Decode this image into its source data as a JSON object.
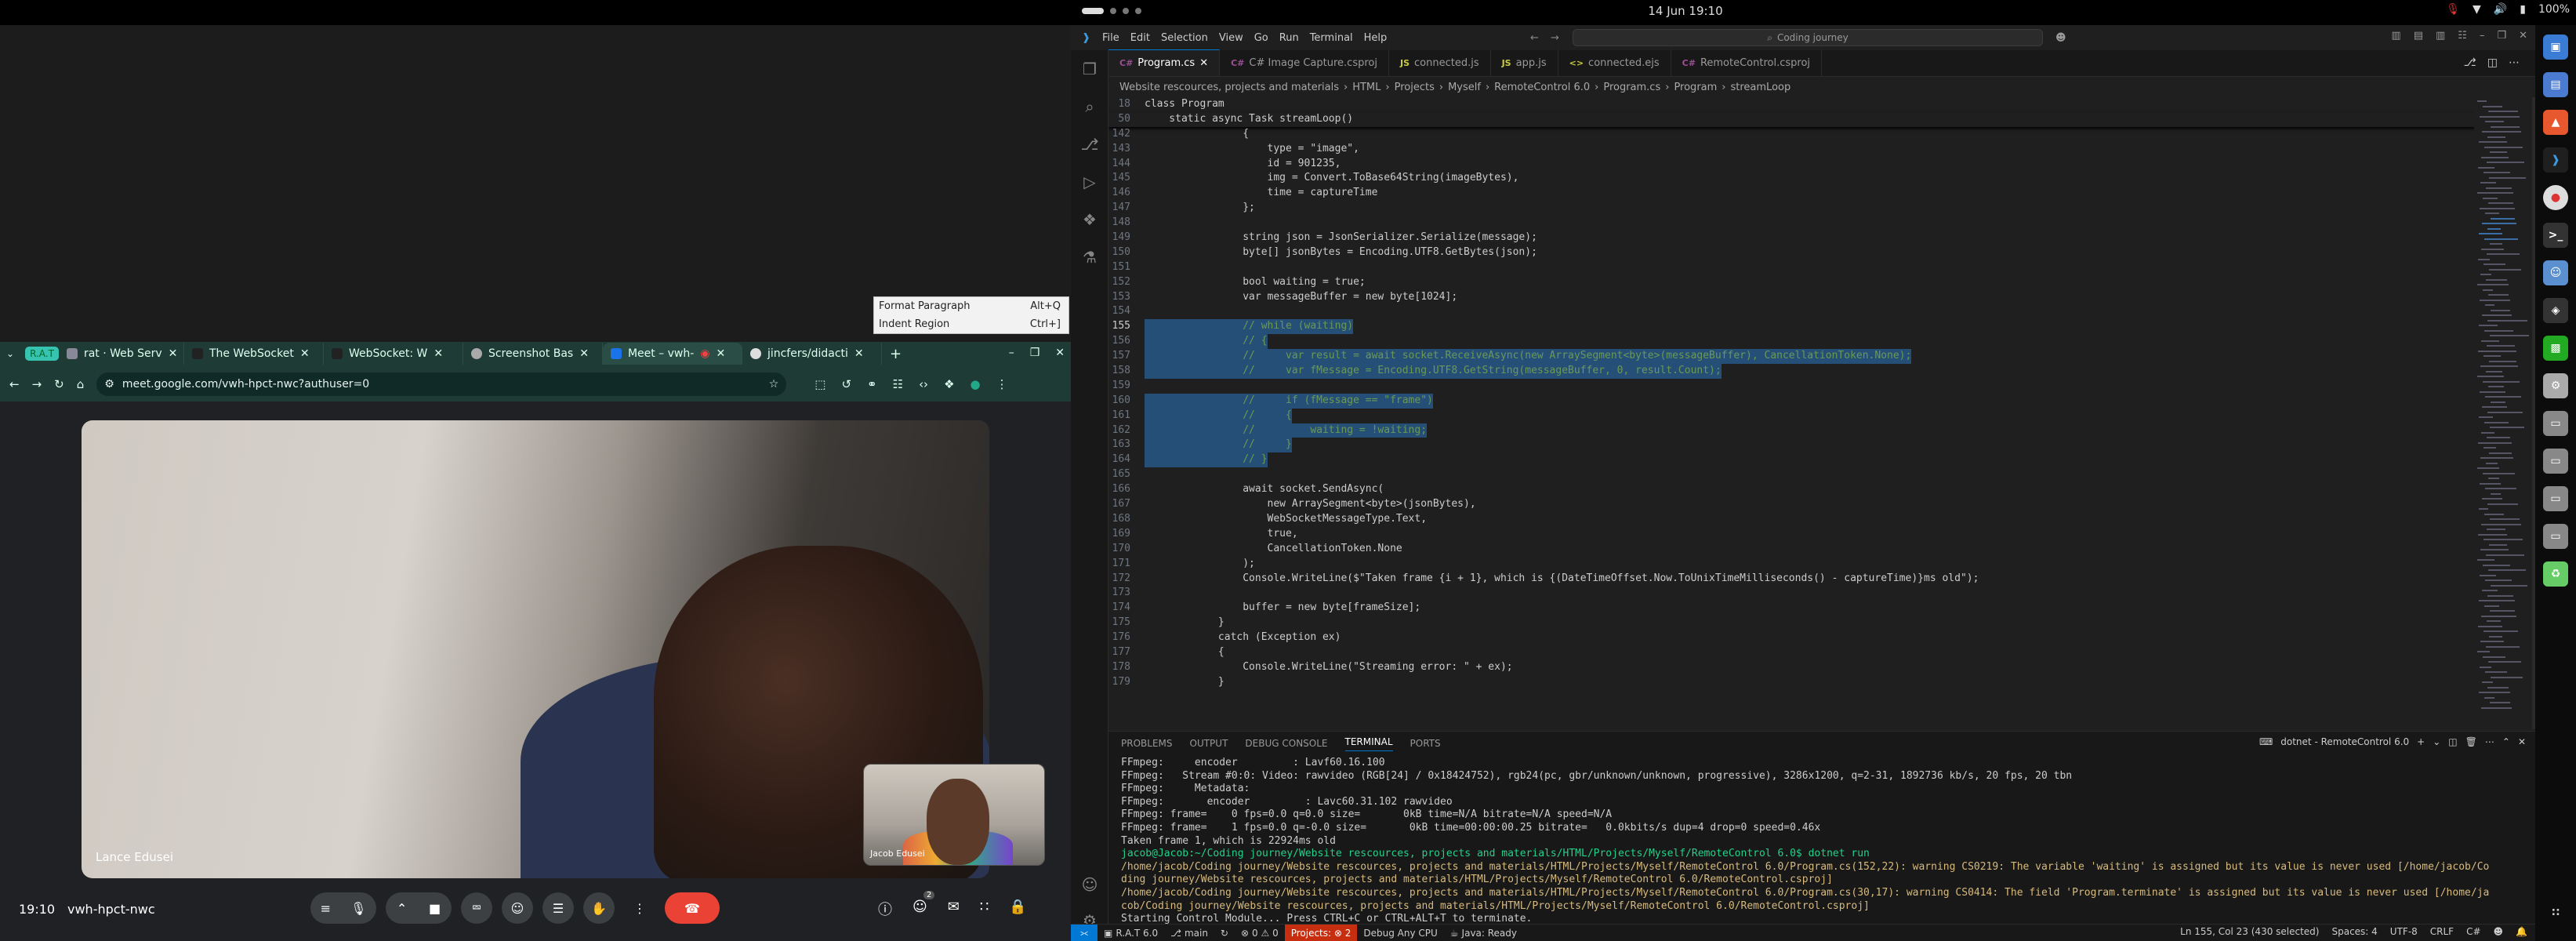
{
  "topbar": {
    "datetime": "14 Jun  19:10",
    "battery": "100%"
  },
  "context_menu": {
    "items": [
      {
        "label": "Format Paragraph",
        "shortcut": "Alt+Q"
      },
      {
        "label": "Indent Region",
        "shortcut": "Ctrl+]"
      }
    ]
  },
  "browser": {
    "tab_group": "R.A.T",
    "tabs": [
      {
        "label": "rat · Web Serv"
      },
      {
        "label": "The WebSocket"
      },
      {
        "label": "WebSocket: W"
      },
      {
        "label": "Screenshot Bas"
      },
      {
        "label": "Meet – vwh-"
      },
      {
        "label": "jincfers/didacti"
      }
    ],
    "url": "meet.google.com/vwh-hpct-nwc?authuser=0"
  },
  "meet": {
    "main_participant": "Lance Edusei",
    "self_participant": "Jacob Edusei",
    "time": "19:10",
    "meeting_code": "vwh-hpct-nwc",
    "people_count": "2"
  },
  "vscode": {
    "menu": [
      "File",
      "Edit",
      "Selection",
      "View",
      "Go",
      "Run",
      "Terminal",
      "Help"
    ],
    "command_center": "Coding journey",
    "tabs": [
      {
        "label": "Program.cs",
        "icon": "C#",
        "color": "#9b4f96"
      },
      {
        "label": "C# Image Capture.csproj",
        "icon": "C#",
        "color": "#9b4f96"
      },
      {
        "label": "connected.js",
        "icon": "JS",
        "color": "#cbcb41"
      },
      {
        "label": "app.js",
        "icon": "JS",
        "color": "#cbcb41"
      },
      {
        "label": "connected.ejs",
        "icon": "<>",
        "color": "#cbcb41"
      },
      {
        "label": "RemoteControl.csproj",
        "icon": "C#",
        "color": "#9b4f96"
      }
    ],
    "breadcrumbs": [
      "Website rescources, projects and materials",
      "HTML",
      "Projects",
      "Myself",
      "RemoteControl 6.0",
      "Program.cs",
      "Program",
      "streamLoop"
    ],
    "sticky_lines": [
      {
        "n": "18",
        "t": "class Program"
      },
      {
        "n": "50",
        "t": "    static async Task streamLoop()"
      }
    ],
    "code_lines": [
      {
        "n": "142",
        "t": "                {"
      },
      {
        "n": "143",
        "t": "                    type = \"image\","
      },
      {
        "n": "144",
        "t": "                    id = 901235,"
      },
      {
        "n": "145",
        "t": "                    img = Convert.ToBase64String(imageBytes),"
      },
      {
        "n": "146",
        "t": "                    time = captureTime"
      },
      {
        "n": "147",
        "t": "                };"
      },
      {
        "n": "148",
        "t": ""
      },
      {
        "n": "149",
        "t": "                string json = JsonSerializer.Serialize(message);"
      },
      {
        "n": "150",
        "t": "                byte[] jsonBytes = Encoding.UTF8.GetBytes(json);"
      },
      {
        "n": "151",
        "t": ""
      },
      {
        "n": "152",
        "t": "                bool waiting = true;"
      },
      {
        "n": "153",
        "t": "                var messageBuffer = new byte[1024];"
      },
      {
        "n": "154",
        "t": ""
      },
      {
        "n": "155",
        "t": "                // while (waiting)"
      },
      {
        "n": "156",
        "t": "                // {"
      },
      {
        "n": "157",
        "t": "                //     var result = await socket.ReceiveAsync(new ArraySegment<byte>(messageBuffer), CancellationToken.None);"
      },
      {
        "n": "158",
        "t": "                //     var fMessage = Encoding.UTF8.GetString(messageBuffer, 0, result.Count);"
      },
      {
        "n": "159",
        "t": ""
      },
      {
        "n": "160",
        "t": "                //     if (fMessage == \"frame\")"
      },
      {
        "n": "161",
        "t": "                //     {"
      },
      {
        "n": "162",
        "t": "                //         waiting = !waiting;"
      },
      {
        "n": "163",
        "t": "                //     }"
      },
      {
        "n": "164",
        "t": "                // }"
      },
      {
        "n": "165",
        "t": ""
      },
      {
        "n": "166",
        "t": "                await socket.SendAsync("
      },
      {
        "n": "167",
        "t": "                    new ArraySegment<byte>(jsonBytes),"
      },
      {
        "n": "168",
        "t": "                    WebSocketMessageType.Text,"
      },
      {
        "n": "169",
        "t": "                    true,"
      },
      {
        "n": "170",
        "t": "                    CancellationToken.None"
      },
      {
        "n": "171",
        "t": "                );"
      },
      {
        "n": "172",
        "t": "                Console.WriteLine($\"Taken frame {i + 1}, which is {(DateTimeOffset.Now.ToUnixTimeMilliseconds() - captureTime)}ms old\");"
      },
      {
        "n": "173",
        "t": ""
      },
      {
        "n": "174",
        "t": "                buffer = new byte[frameSize];"
      },
      {
        "n": "175",
        "t": "            }"
      },
      {
        "n": "176",
        "t": "            catch (Exception ex)"
      },
      {
        "n": "177",
        "t": "            {"
      },
      {
        "n": "178",
        "t": "                Console.WriteLine(\"Streaming error: \" + ex);"
      },
      {
        "n": "179",
        "t": "            }"
      }
    ],
    "panel_tabs": [
      "PROBLEMS",
      "OUTPUT",
      "DEBUG CONSOLE",
      "TERMINAL",
      "PORTS"
    ],
    "terminal_name": "dotnet - RemoteControl 6.0",
    "terminal_lines": [
      {
        "t": "FFmpeg:     encoder         : Lavf60.16.100",
        "k": ""
      },
      {
        "t": "FFmpeg:   Stream #0:0: Video: rawvideo (RGB[24] / 0x18424752), rgb24(pc, gbr/unknown/unknown, progressive), 3286x1200, q=2-31, 1892736 kb/s, 20 fps, 20 tbn",
        "k": ""
      },
      {
        "t": "FFmpeg:     Metadata:",
        "k": ""
      },
      {
        "t": "FFmpeg:       encoder         : Lavc60.31.102 rawvideo",
        "k": ""
      },
      {
        "t": "FFmpeg: frame=    0 fps=0.0 q=0.0 size=       0kB time=N/A bitrate=N/A speed=N/A",
        "k": ""
      },
      {
        "t": "FFmpeg: frame=    1 fps=0.0 q=-0.0 size=       0kB time=00:00:00.25 bitrate=   0.0kbits/s dup=4 drop=0 speed=0.46x",
        "k": ""
      },
      {
        "t": "Taken frame 1, which is 22924ms old",
        "k": ""
      },
      {
        "t": "jacob@Jacob:~/Coding journey/Website rescources, projects and materials/HTML/Projects/Myself/RemoteControl 6.0$ dotnet run",
        "k": "prompt"
      },
      {
        "t": "/home/jacob/Coding journey/Website rescources, projects and materials/HTML/Projects/Myself/RemoteControl 6.0/Program.cs(152,22): warning CS0219: The variable 'waiting' is assigned but its value is never used [/home/jacob/Co",
        "k": "warn"
      },
      {
        "t": "ding journey/Website rescources, projects and materials/HTML/Projects/Myself/RemoteControl 6.0/RemoteControl.csproj]",
        "k": "warn"
      },
      {
        "t": "/home/jacob/Coding journey/Website rescources, projects and materials/HTML/Projects/Myself/RemoteControl 6.0/Program.cs(30,17): warning CS0414: The field 'Program.terminate' is assigned but its value is never used [/home/ja",
        "k": "warn"
      },
      {
        "t": "cob/Coding journey/Website rescources, projects and materials/HTML/Projects/Myself/RemoteControl 6.0/RemoteControl.csproj]",
        "k": "warn"
      },
      {
        "t": "Starting Control Module... Press CTRL+C or CTRL+ALT+T to terminate.",
        "k": ""
      },
      {
        "t": "[]",
        "k": ""
      }
    ],
    "status": {
      "ext": "R.A.T 6.0",
      "branch": "main",
      "problems": "0 ⚠ 0",
      "projects": "Projects: ⊗ 2",
      "debug": "Debug Any CPU",
      "java": "Java: Ready",
      "cursor": "Ln 155, Col 23 (430 selected)",
      "spaces": "Spaces: 4",
      "encoding": "UTF-8",
      "eol": "CRLF",
      "lang": "C#"
    }
  }
}
